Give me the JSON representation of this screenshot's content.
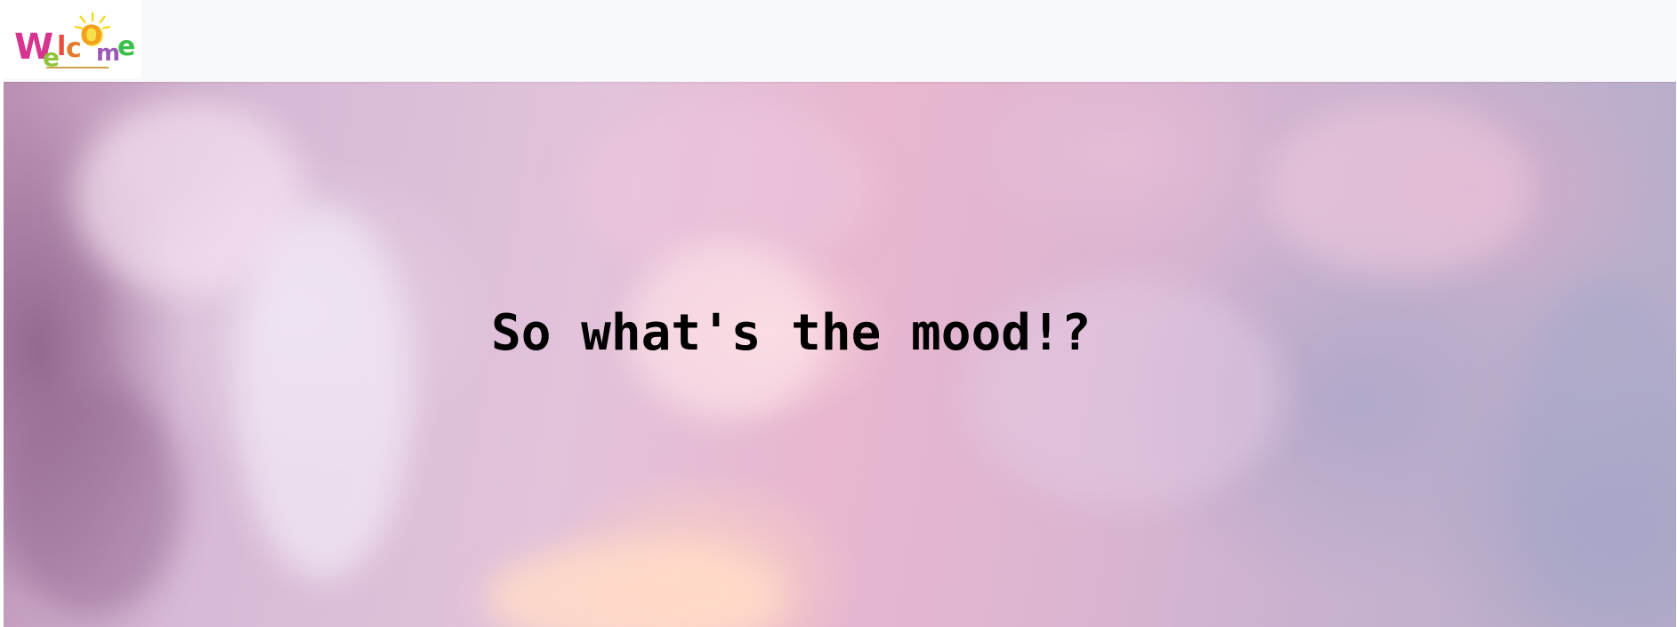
{
  "navbar": {
    "logo_text": "Welcome",
    "background_color": "#f8f9fa"
  },
  "hero": {
    "headline": "So what's the mood!?",
    "background": "pink-purple cloudy sky"
  }
}
